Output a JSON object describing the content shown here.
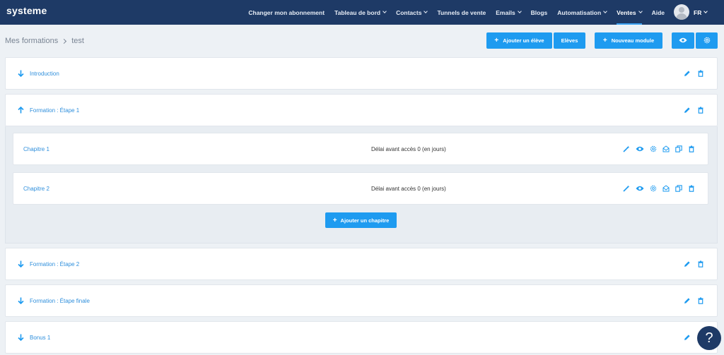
{
  "app": {
    "logo": "systeme"
  },
  "nav": {
    "items": [
      {
        "label": "Changer mon abonnement",
        "dropdown": false,
        "active": false
      },
      {
        "label": "Tableau de bord",
        "dropdown": true,
        "active": false
      },
      {
        "label": "Contacts",
        "dropdown": true,
        "active": false
      },
      {
        "label": "Tunnels de vente",
        "dropdown": false,
        "active": false
      },
      {
        "label": "Emails",
        "dropdown": true,
        "active": false
      },
      {
        "label": "Blogs",
        "dropdown": false,
        "active": false
      },
      {
        "label": "Automatisation",
        "dropdown": true,
        "active": false
      },
      {
        "label": "Ventes",
        "dropdown": true,
        "active": true
      },
      {
        "label": "Aide",
        "dropdown": false,
        "active": false
      }
    ],
    "language": "FR"
  },
  "breadcrumb": {
    "parent": "Mes formations",
    "current": "test"
  },
  "toolbar": {
    "add_student": "Ajouter un élève",
    "students": "Elèves",
    "new_module": "Nouveau module"
  },
  "modules": [
    {
      "title": "Introduction",
      "expanded": false
    },
    {
      "title": "Formation : Étape 1",
      "expanded": true
    },
    {
      "title": "Formation : Étape 2",
      "expanded": false
    },
    {
      "title": "Formation : Étape finale",
      "expanded": false
    },
    {
      "title": "Bonus 1",
      "expanded": false
    }
  ],
  "chapters": [
    {
      "title": "Chapitre 1",
      "delay": "Délai avant accès 0 (en jours)"
    },
    {
      "title": "Chapitre 2",
      "delay": "Délai avant accès 0 (en jours)"
    }
  ],
  "add_chapter": "Ajouter un chapitre",
  "help": {
    "label": "?"
  },
  "colors": {
    "nav_bg": "#1e3a66",
    "accent": "#1e9bf0",
    "link": "#2f8fdc",
    "page_bg": "#edf1f5"
  }
}
